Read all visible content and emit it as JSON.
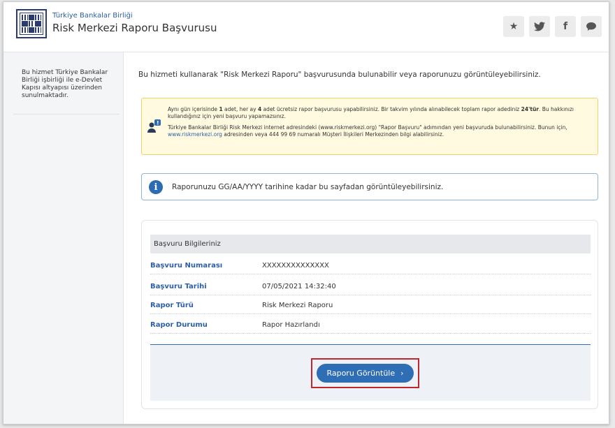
{
  "header": {
    "org_name": "Türkiye Bankalar Birliği",
    "title": "Risk Merkezi Raporu Başvurusu",
    "social": [
      {
        "icon": "star-icon",
        "glyph": "★"
      },
      {
        "icon": "twitter-icon",
        "glyph": "🐦"
      },
      {
        "icon": "facebook-icon",
        "glyph": "f"
      },
      {
        "icon": "chat-icon",
        "glyph": "💬"
      }
    ]
  },
  "sidebar": {
    "text": "Bu hizmet Türkiye Bankalar Birliği işbirliği ile e-Devlet Kapısı altyapısı üzerinden sunulmaktadır."
  },
  "main": {
    "intro": "Bu hizmeti kullanarak \"Risk Merkezi Raporu\" başvurusunda bulunabilir veya raporunuzu görüntüleyebilirsiniz.",
    "notice": {
      "p1_a": "Aynı gün içerisinde ",
      "p1_b": "1",
      "p1_c": " adet, her ay ",
      "p1_d": "4",
      "p1_e": " adet ücretsiz rapor başvurusu yapabilirsiniz. Bir takvim yılında alınabilecek toplam rapor adediniz ",
      "p1_f": "24'tür",
      "p1_g": ". Bu hakkınızı kullandığınız için yeni başvuru yapamazsınız.",
      "p2_a": "Türkiye Bankalar Birliği Risk Merkezi internet adresindeki (www.riskmerkezi.org) \"Rapor Başvuru\" adımından yeni başvuruda bulunabilirsiniz. Bunun için, ",
      "p2_link": "www.riskmerkezi.org",
      "p2_b": " adresinden veya 444 99 69 numaralı Müşteri İlişkileri Merkezinden bilgi alabilirsiniz."
    },
    "info": "Raporunuzu GG/AA/YYYY tarihine kadar bu sayfadan görüntüleyebilirsiniz.",
    "card": {
      "title": "Başvuru Bilgileriniz",
      "rows": [
        {
          "label": "Başvuru Numarası",
          "value": "XXXXXXXXXXXXXX"
        },
        {
          "label": "Başvuru Tarihi",
          "value": "07/05/2021 14:32:40"
        },
        {
          "label": "Rapor Türü",
          "value": "Risk Merkezi Raporu"
        },
        {
          "label": "Rapor Durumu",
          "value": "Rapor Hazırlandı"
        }
      ],
      "button": "Raporu Görüntüle",
      "button_chevron": "›"
    }
  }
}
